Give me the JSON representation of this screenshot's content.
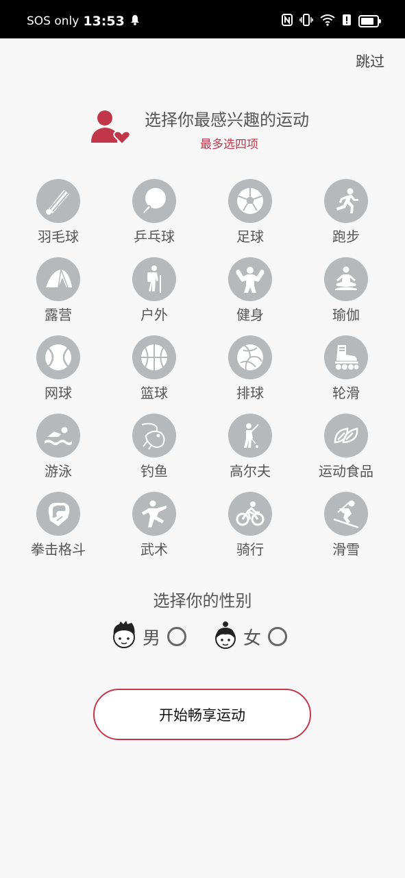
{
  "status_bar": {
    "carrier": "SOS only",
    "time": "13:53",
    "icons": [
      "bell-icon",
      "nfc-icon",
      "vibrate-icon",
      "wifi-icon",
      "alert-icon",
      "battery-icon"
    ]
  },
  "skip_label": "跳过",
  "header": {
    "title": "选择你最感兴趣的运动",
    "subtitle": "最多选四项",
    "accent_color": "#c2364a"
  },
  "sports": [
    {
      "label": "羽毛球",
      "icon": "badminton-icon"
    },
    {
      "label": "乒乓球",
      "icon": "table-tennis-icon"
    },
    {
      "label": "足球",
      "icon": "football-icon"
    },
    {
      "label": "跑步",
      "icon": "running-icon"
    },
    {
      "label": "露营",
      "icon": "camping-icon"
    },
    {
      "label": "户外",
      "icon": "hiking-icon"
    },
    {
      "label": "健身",
      "icon": "fitness-icon"
    },
    {
      "label": "瑜伽",
      "icon": "yoga-icon"
    },
    {
      "label": "网球",
      "icon": "tennis-icon"
    },
    {
      "label": "篮球",
      "icon": "basketball-icon"
    },
    {
      "label": "排球",
      "icon": "volleyball-icon"
    },
    {
      "label": "轮滑",
      "icon": "roller-skate-icon"
    },
    {
      "label": "游泳",
      "icon": "swimming-icon"
    },
    {
      "label": "钓鱼",
      "icon": "fishing-icon"
    },
    {
      "label": "高尔夫",
      "icon": "golf-icon"
    },
    {
      "label": "运动食品",
      "icon": "sports-food-icon"
    },
    {
      "label": "拳击格斗",
      "icon": "boxing-icon"
    },
    {
      "label": "武术",
      "icon": "martial-arts-icon"
    },
    {
      "label": "骑行",
      "icon": "cycling-icon"
    },
    {
      "label": "滑雪",
      "icon": "skiing-icon"
    }
  ],
  "gender": {
    "title": "选择你的性别",
    "male_label": "男",
    "female_label": "女"
  },
  "start_button": "开始畅享运动"
}
